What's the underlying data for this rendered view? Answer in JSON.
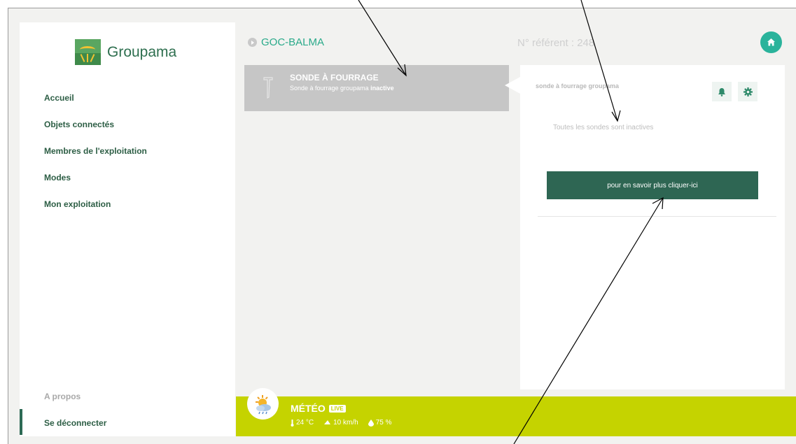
{
  "brand": {
    "name": "Groupama"
  },
  "nav": {
    "items": [
      {
        "label": "Accueil"
      },
      {
        "label": "Objets connectés"
      },
      {
        "label": "Membres de l'exploitation"
      },
      {
        "label": "Modes"
      },
      {
        "label": "Mon exploitation"
      }
    ],
    "about": "A propos",
    "logout": "Se déconnecter"
  },
  "header": {
    "site_name": "GOC-BALMA",
    "reference": "N° référent : 248"
  },
  "sensor_card": {
    "title": "SONDE À FOURRAGE",
    "subtitle_prefix": "Sonde à fourrage groupama ",
    "subtitle_status": "inactive"
  },
  "panel": {
    "title": "sonde à fourrage groupama",
    "message": "Toutes les sondes sont inactives",
    "info_button": "pour en savoir plus cliquer-ici"
  },
  "meteo": {
    "title": "MÉTÉO",
    "live": "LIVE",
    "temperature": "24 °C",
    "wind": "10 km/h",
    "humidity": "75 %"
  },
  "colors": {
    "brand_green": "#2e6653",
    "accent_teal": "#2ab39b",
    "meteo_bg": "#c5d300",
    "card_grey": "#c6c6c6"
  },
  "icons": [
    "home-icon",
    "bell-icon",
    "gear-icon",
    "sensor-probe-icon",
    "weather-icon",
    "thermometer-icon",
    "wind-icon",
    "drop-icon"
  ]
}
